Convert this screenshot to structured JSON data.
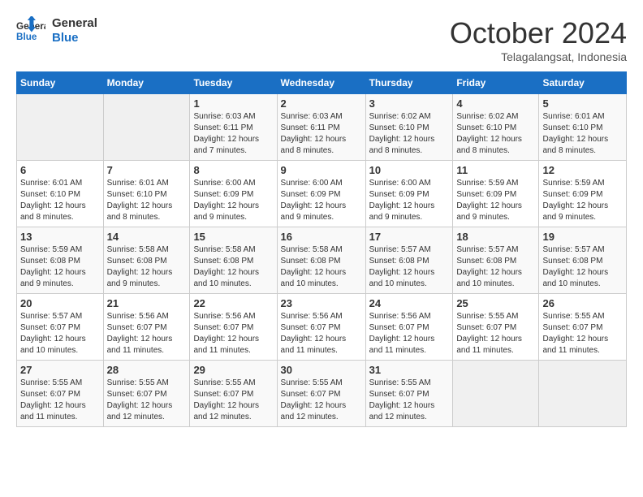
{
  "header": {
    "logo_line1": "General",
    "logo_line2": "Blue",
    "month": "October 2024",
    "location": "Telagalangsat, Indonesia"
  },
  "weekdays": [
    "Sunday",
    "Monday",
    "Tuesday",
    "Wednesday",
    "Thursday",
    "Friday",
    "Saturday"
  ],
  "weeks": [
    [
      {
        "day": "",
        "sunrise": "",
        "sunset": "",
        "daylight": ""
      },
      {
        "day": "",
        "sunrise": "",
        "sunset": "",
        "daylight": ""
      },
      {
        "day": "1",
        "sunrise": "Sunrise: 6:03 AM",
        "sunset": "Sunset: 6:11 PM",
        "daylight": "Daylight: 12 hours and 7 minutes."
      },
      {
        "day": "2",
        "sunrise": "Sunrise: 6:03 AM",
        "sunset": "Sunset: 6:11 PM",
        "daylight": "Daylight: 12 hours and 8 minutes."
      },
      {
        "day": "3",
        "sunrise": "Sunrise: 6:02 AM",
        "sunset": "Sunset: 6:10 PM",
        "daylight": "Daylight: 12 hours and 8 minutes."
      },
      {
        "day": "4",
        "sunrise": "Sunrise: 6:02 AM",
        "sunset": "Sunset: 6:10 PM",
        "daylight": "Daylight: 12 hours and 8 minutes."
      },
      {
        "day": "5",
        "sunrise": "Sunrise: 6:01 AM",
        "sunset": "Sunset: 6:10 PM",
        "daylight": "Daylight: 12 hours and 8 minutes."
      }
    ],
    [
      {
        "day": "6",
        "sunrise": "Sunrise: 6:01 AM",
        "sunset": "Sunset: 6:10 PM",
        "daylight": "Daylight: 12 hours and 8 minutes."
      },
      {
        "day": "7",
        "sunrise": "Sunrise: 6:01 AM",
        "sunset": "Sunset: 6:10 PM",
        "daylight": "Daylight: 12 hours and 8 minutes."
      },
      {
        "day": "8",
        "sunrise": "Sunrise: 6:00 AM",
        "sunset": "Sunset: 6:09 PM",
        "daylight": "Daylight: 12 hours and 9 minutes."
      },
      {
        "day": "9",
        "sunrise": "Sunrise: 6:00 AM",
        "sunset": "Sunset: 6:09 PM",
        "daylight": "Daylight: 12 hours and 9 minutes."
      },
      {
        "day": "10",
        "sunrise": "Sunrise: 6:00 AM",
        "sunset": "Sunset: 6:09 PM",
        "daylight": "Daylight: 12 hours and 9 minutes."
      },
      {
        "day": "11",
        "sunrise": "Sunrise: 5:59 AM",
        "sunset": "Sunset: 6:09 PM",
        "daylight": "Daylight: 12 hours and 9 minutes."
      },
      {
        "day": "12",
        "sunrise": "Sunrise: 5:59 AM",
        "sunset": "Sunset: 6:09 PM",
        "daylight": "Daylight: 12 hours and 9 minutes."
      }
    ],
    [
      {
        "day": "13",
        "sunrise": "Sunrise: 5:59 AM",
        "sunset": "Sunset: 6:08 PM",
        "daylight": "Daylight: 12 hours and 9 minutes."
      },
      {
        "day": "14",
        "sunrise": "Sunrise: 5:58 AM",
        "sunset": "Sunset: 6:08 PM",
        "daylight": "Daylight: 12 hours and 9 minutes."
      },
      {
        "day": "15",
        "sunrise": "Sunrise: 5:58 AM",
        "sunset": "Sunset: 6:08 PM",
        "daylight": "Daylight: 12 hours and 10 minutes."
      },
      {
        "day": "16",
        "sunrise": "Sunrise: 5:58 AM",
        "sunset": "Sunset: 6:08 PM",
        "daylight": "Daylight: 12 hours and 10 minutes."
      },
      {
        "day": "17",
        "sunrise": "Sunrise: 5:57 AM",
        "sunset": "Sunset: 6:08 PM",
        "daylight": "Daylight: 12 hours and 10 minutes."
      },
      {
        "day": "18",
        "sunrise": "Sunrise: 5:57 AM",
        "sunset": "Sunset: 6:08 PM",
        "daylight": "Daylight: 12 hours and 10 minutes."
      },
      {
        "day": "19",
        "sunrise": "Sunrise: 5:57 AM",
        "sunset": "Sunset: 6:08 PM",
        "daylight": "Daylight: 12 hours and 10 minutes."
      }
    ],
    [
      {
        "day": "20",
        "sunrise": "Sunrise: 5:57 AM",
        "sunset": "Sunset: 6:07 PM",
        "daylight": "Daylight: 12 hours and 10 minutes."
      },
      {
        "day": "21",
        "sunrise": "Sunrise: 5:56 AM",
        "sunset": "Sunset: 6:07 PM",
        "daylight": "Daylight: 12 hours and 11 minutes."
      },
      {
        "day": "22",
        "sunrise": "Sunrise: 5:56 AM",
        "sunset": "Sunset: 6:07 PM",
        "daylight": "Daylight: 12 hours and 11 minutes."
      },
      {
        "day": "23",
        "sunrise": "Sunrise: 5:56 AM",
        "sunset": "Sunset: 6:07 PM",
        "daylight": "Daylight: 12 hours and 11 minutes."
      },
      {
        "day": "24",
        "sunrise": "Sunrise: 5:56 AM",
        "sunset": "Sunset: 6:07 PM",
        "daylight": "Daylight: 12 hours and 11 minutes."
      },
      {
        "day": "25",
        "sunrise": "Sunrise: 5:55 AM",
        "sunset": "Sunset: 6:07 PM",
        "daylight": "Daylight: 12 hours and 11 minutes."
      },
      {
        "day": "26",
        "sunrise": "Sunrise: 5:55 AM",
        "sunset": "Sunset: 6:07 PM",
        "daylight": "Daylight: 12 hours and 11 minutes."
      }
    ],
    [
      {
        "day": "27",
        "sunrise": "Sunrise: 5:55 AM",
        "sunset": "Sunset: 6:07 PM",
        "daylight": "Daylight: 12 hours and 11 minutes."
      },
      {
        "day": "28",
        "sunrise": "Sunrise: 5:55 AM",
        "sunset": "Sunset: 6:07 PM",
        "daylight": "Daylight: 12 hours and 12 minutes."
      },
      {
        "day": "29",
        "sunrise": "Sunrise: 5:55 AM",
        "sunset": "Sunset: 6:07 PM",
        "daylight": "Daylight: 12 hours and 12 minutes."
      },
      {
        "day": "30",
        "sunrise": "Sunrise: 5:55 AM",
        "sunset": "Sunset: 6:07 PM",
        "daylight": "Daylight: 12 hours and 12 minutes."
      },
      {
        "day": "31",
        "sunrise": "Sunrise: 5:55 AM",
        "sunset": "Sunset: 6:07 PM",
        "daylight": "Daylight: 12 hours and 12 minutes."
      },
      {
        "day": "",
        "sunrise": "",
        "sunset": "",
        "daylight": ""
      },
      {
        "day": "",
        "sunrise": "",
        "sunset": "",
        "daylight": ""
      }
    ]
  ]
}
